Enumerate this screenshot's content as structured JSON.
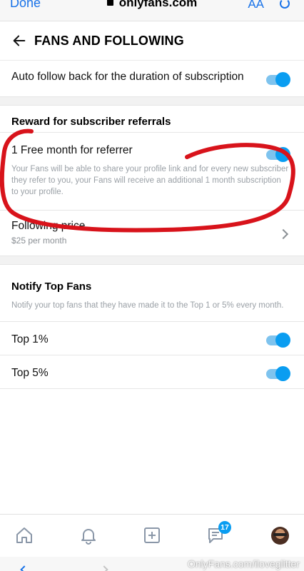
{
  "browser": {
    "done_label": "Done",
    "url": "onlyfans.com",
    "text_size_label": "AA"
  },
  "header": {
    "title": "FANS AND FOLLOWING"
  },
  "auto_follow": {
    "label": "Auto follow back for the duration of subscription",
    "enabled": true
  },
  "referrals": {
    "section_title": "Reward for subscriber referrals",
    "free_month": {
      "label": "1 Free month for referrer",
      "enabled": true,
      "description": "Your Fans will be able to share your profile link and for every new subscriber they refer to you, your Fans will receive an additional 1 month subscription to your profile."
    },
    "following_price": {
      "label": "Following price",
      "value": "$25 per month"
    }
  },
  "notify": {
    "title": "Notify Top Fans",
    "description": "Notify your top fans that they have made it to the Top 1 or 5% every month.",
    "options": [
      {
        "label": "Top 1%",
        "enabled": true
      },
      {
        "label": "Top 5%",
        "enabled": true
      }
    ]
  },
  "tabbar": {
    "items": [
      "home-icon",
      "bell-icon",
      "plus-square-icon",
      "chat-icon",
      "avatar"
    ],
    "messages_badge": "17"
  },
  "watermark": "OnlyFans.com/iloveglitter",
  "colors": {
    "accent": "#0a9df1",
    "annotation": "#d8131b"
  }
}
